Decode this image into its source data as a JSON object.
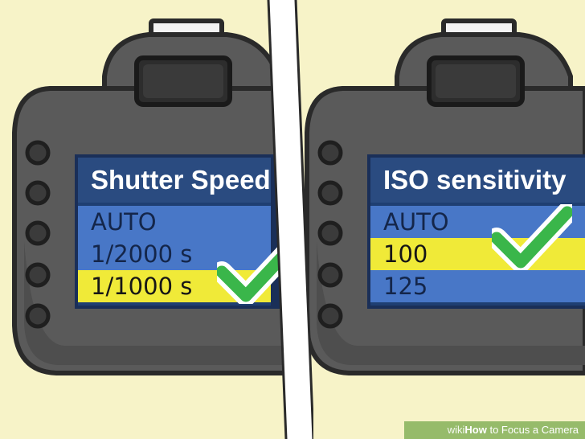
{
  "panels": [
    {
      "menu_title": "Shutter Speed",
      "options": [
        "AUTO",
        "1/2000 s",
        "1/1000 s"
      ],
      "selected_index": 2
    },
    {
      "menu_title": "ISO sensitivity",
      "options": [
        "AUTO",
        "100",
        "125"
      ],
      "selected_index": 1
    }
  ],
  "footer": {
    "brand_prefix": "wiki",
    "brand_main": "How",
    "text": " to Focus a Camera"
  },
  "colors": {
    "background": "#f7f3c8",
    "camera_body": "#5a5a5a",
    "menu_title_bg": "#2a4b80",
    "menu_row_bg": "#4877c7",
    "selected_row_bg": "#f0ea38",
    "check": "#3ab64a"
  },
  "icons": [
    "camera-body-icon",
    "checkmark-icon"
  ]
}
